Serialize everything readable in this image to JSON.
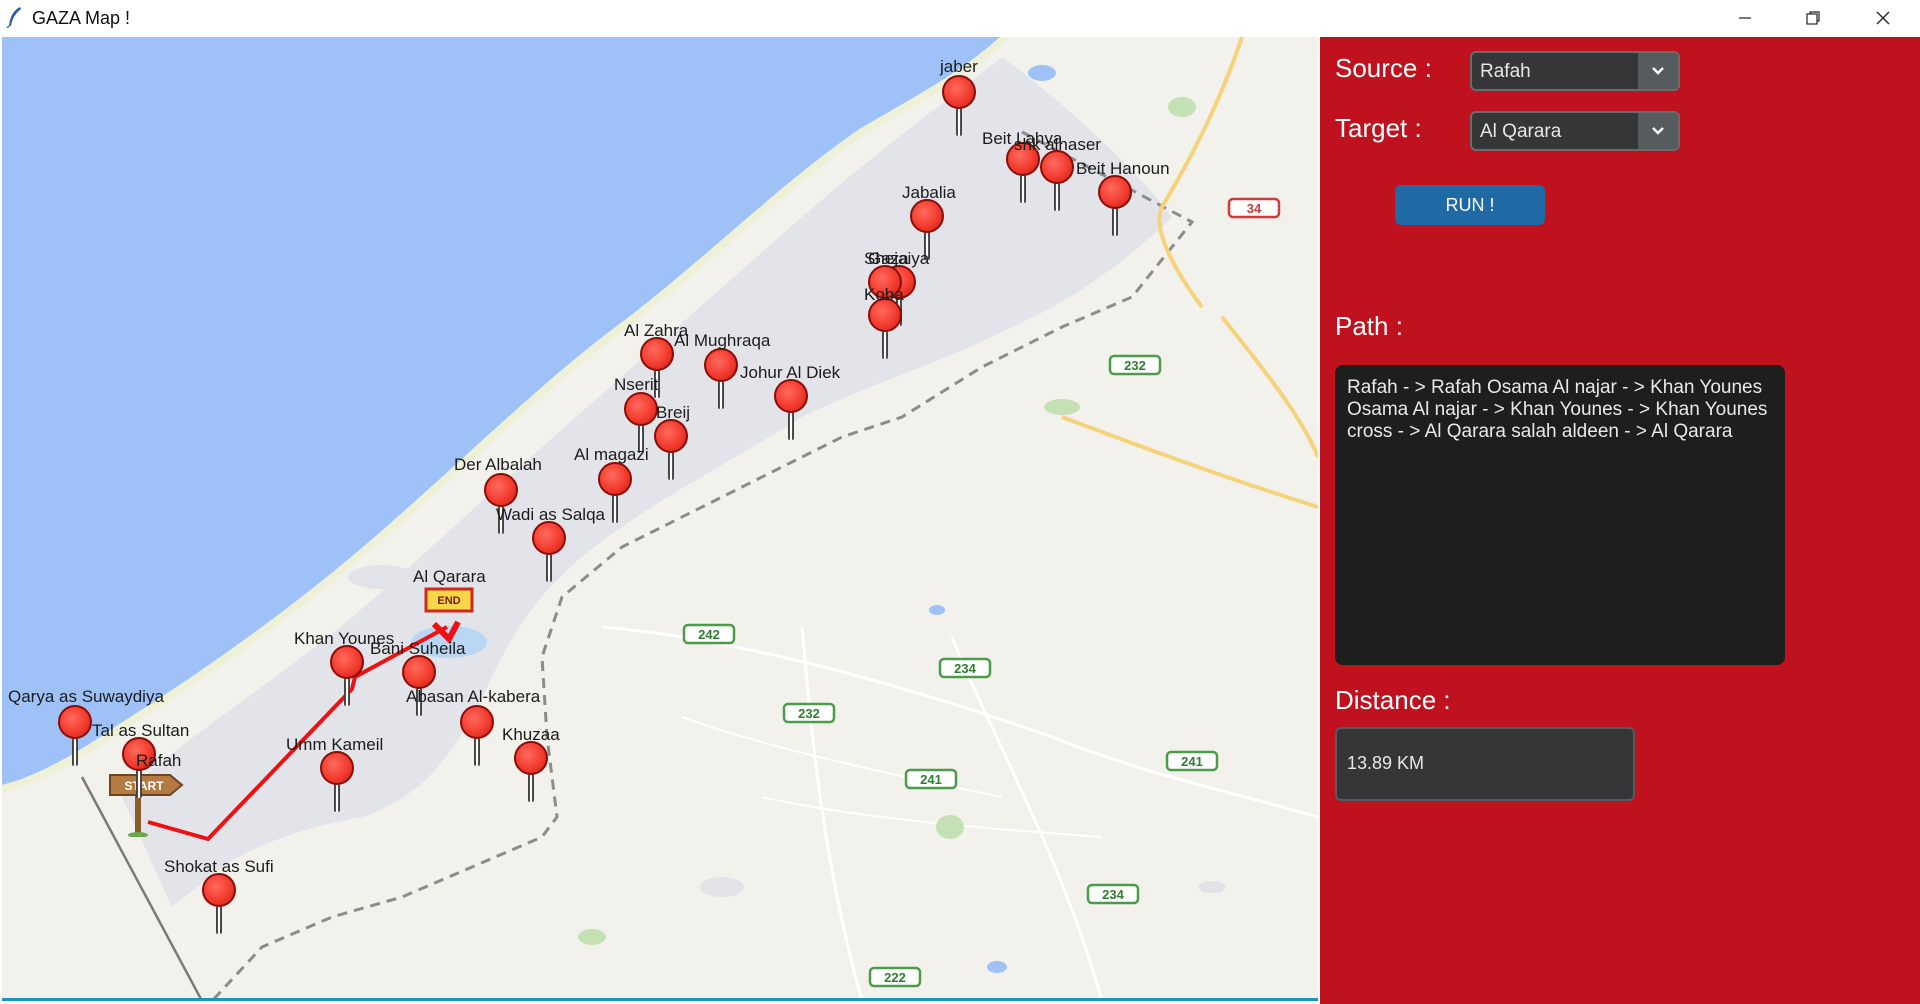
{
  "window": {
    "title": "GAZA Map !",
    "controls": {
      "minimize": "minimize-icon",
      "maximize": "restore-icon",
      "close": "close-icon"
    }
  },
  "map": {
    "markers": [
      {
        "name": "jaber"
      },
      {
        "name": "Beit Lahya"
      },
      {
        "name": "shk alnaser"
      },
      {
        "name": "Beit Hanoun"
      },
      {
        "name": "Jabalia"
      },
      {
        "name": "Shejaiya"
      },
      {
        "name": "Gaza"
      },
      {
        "name": "Koba"
      },
      {
        "name": "Al Zahra"
      },
      {
        "name": "Al Mughraqa"
      },
      {
        "name": "Johur Al Diek"
      },
      {
        "name": "Nserit"
      },
      {
        "name": "Breij"
      },
      {
        "name": "Al magazi"
      },
      {
        "name": "Der Albalah"
      },
      {
        "name": "Wadi as Salqa"
      },
      {
        "name": "Al Qarara"
      },
      {
        "name": "Khan Younes"
      },
      {
        "name": "Bani Suheila"
      },
      {
        "name": "Abasan Al-kabera"
      },
      {
        "name": "Qarya as Suwaydiya"
      },
      {
        "name": "Tal as Sultan"
      },
      {
        "name": "Rafah"
      },
      {
        "name": "Umm Kameil"
      },
      {
        "name": "Khuzaa"
      },
      {
        "name": "Shokat as Sufi"
      }
    ],
    "road_badges": [
      "34",
      "232",
      "242",
      "234",
      "232",
      "241",
      "241",
      "234",
      "222"
    ],
    "end_sign": "END",
    "start_sign": "START",
    "colors": {
      "sea": "#9ec1f7",
      "land": "#f3f1ec",
      "urban": "#e2e3e8",
      "route": "#ee1111",
      "marker": "#f23b2e"
    }
  },
  "panel": {
    "source_label": "Source :",
    "source_value": "Rafah",
    "target_label": "Target :",
    "target_value": "Al Qarara",
    "run_label": "RUN !",
    "path_label": "Path :",
    "path_text": "Rafah - > Rafah Osama Al najar - > Khan Younes Osama Al najar - > Khan Younes - > Khan Younes cross - > Al Qarara salah aldeen - > Al Qarara",
    "distance_label": "Distance :",
    "distance_value": "13.89 KM",
    "colors": {
      "background": "#c0111f",
      "button": "#1f6aa5",
      "textbox": "#1d1e1e"
    }
  }
}
